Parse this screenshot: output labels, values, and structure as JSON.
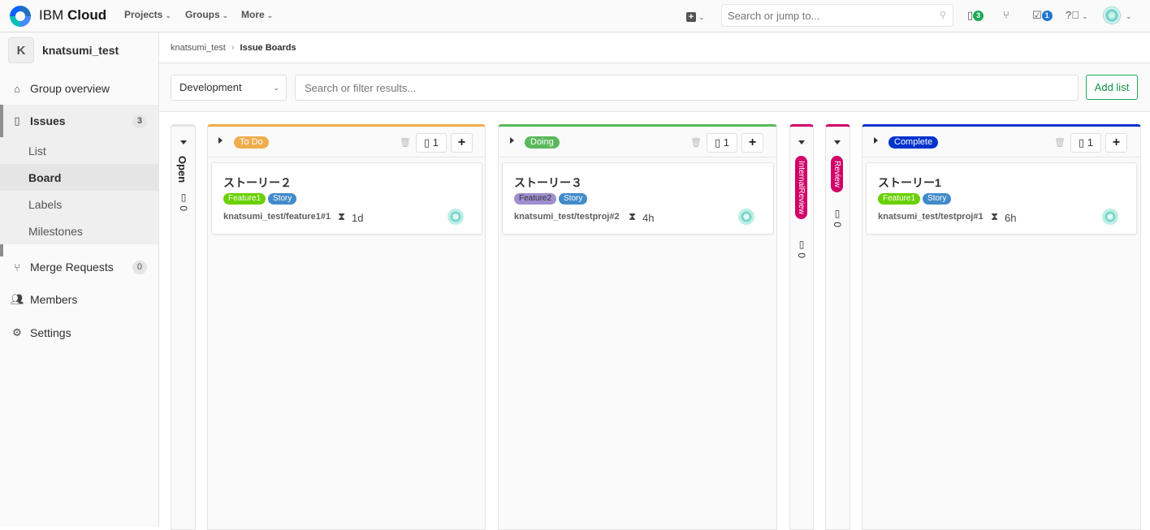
{
  "topbar": {
    "brand_light": "IBM",
    "brand_bold": "Cloud",
    "nav": [
      "Projects",
      "Groups",
      "More"
    ],
    "search_placeholder": "Search or jump to...",
    "issues_count": "3",
    "todos_count": "1"
  },
  "sidebar": {
    "group_initial": "K",
    "group_name": "knatsumi_test",
    "group_overview": "Group overview",
    "issues": "Issues",
    "issues_count": "3",
    "sub": [
      "List",
      "Board",
      "Labels",
      "Milestones"
    ],
    "merge_requests": "Merge Requests",
    "mr_count": "0",
    "members": "Members",
    "settings": "Settings"
  },
  "breadcrumb": {
    "group": "knatsumi_test",
    "current": "Issue Boards"
  },
  "filter": {
    "board": "Development",
    "search_placeholder": "Search or filter results...",
    "add_list": "Add list"
  },
  "lists": {
    "open": {
      "title": "Open",
      "count": "0"
    },
    "todo": {
      "label": "To Do",
      "count": "1",
      "color": "#f0ad4e"
    },
    "doing": {
      "label": "Doing",
      "count": "1",
      "color": "#5cb85c"
    },
    "internal": {
      "label": "InternalReview",
      "count": "0",
      "color": "#d10069"
    },
    "review": {
      "label": "Review",
      "count": "0",
      "color": "#d10069"
    },
    "complete": {
      "label": "Complete",
      "count": "1",
      "color": "#0033cc"
    }
  },
  "cards": {
    "todo": {
      "title": "ストーリー２",
      "labels": [
        "Feature1",
        "Story"
      ],
      "ref": "knatsumi_test/feature1#1",
      "estimate": "1d"
    },
    "doing": {
      "title": "ストーリー３",
      "labels": [
        "Feature2",
        "Story"
      ],
      "ref": "knatsumi_test/testproj#2",
      "estimate": "4h"
    },
    "complete": {
      "title": "ストーリー1",
      "labels": [
        "Feature1",
        "Story"
      ],
      "ref": "knatsumi_test/testproj#1",
      "estimate": "6h"
    }
  },
  "colors": {
    "feature1": "#69d100",
    "feature2": "#9e8fd0",
    "story": "#428bca"
  }
}
